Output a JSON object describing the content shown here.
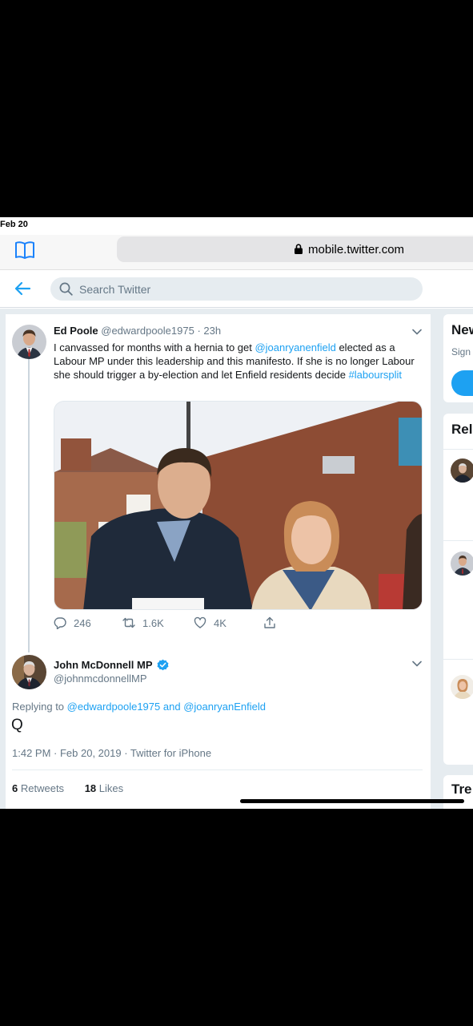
{
  "status_bar": {
    "date": "Feb 20"
  },
  "browser": {
    "url": "mobile.twitter.com"
  },
  "header": {
    "search_placeholder": "Search Twitter"
  },
  "parent_tweet": {
    "name": "Ed Poole",
    "handle": "@edwardpoole1975",
    "separator": "·",
    "time": "23h",
    "text_parts": [
      "I canvassed for months with a hernia to get ",
      "@joanryanenfield",
      " elected as a Labour MP under this leadership and this manifesto. If she is no longer Labour she should trigger a by-election and let Enfield residents decide ",
      "#laboursplit"
    ],
    "replies": "246",
    "retweets": "1.6K",
    "likes": "4K"
  },
  "focused_tweet": {
    "name": "John McDonnell MP",
    "handle": "@johnmcdonnellMP",
    "replying_prefix": "Replying to",
    "replying_to_1": "@edwardpoole1975",
    "replying_joiner": "and",
    "replying_to_2": "@joanryanEnfield",
    "text": "Q",
    "meta": "1:42 PM · Feb 20, 2019 · Twitter for iPhone",
    "retweet_count": "6",
    "retweet_label": "Retweets",
    "like_count": "18",
    "like_label": "Likes"
  },
  "sidebar": {
    "new_title": "New",
    "new_sub": "Sign",
    "relevant_title": "Rele",
    "trends_title": "Tre"
  },
  "colors": {
    "accent": "#1da1f2",
    "background": "#e6ecf0",
    "secondary_text": "#657786"
  },
  "icons": [
    "bookmarks-icon",
    "lock-icon",
    "back-arrow-icon",
    "search-icon",
    "chevron-down-icon",
    "reply-icon",
    "retweet-icon",
    "like-icon",
    "share-icon",
    "verified-badge-icon"
  ]
}
